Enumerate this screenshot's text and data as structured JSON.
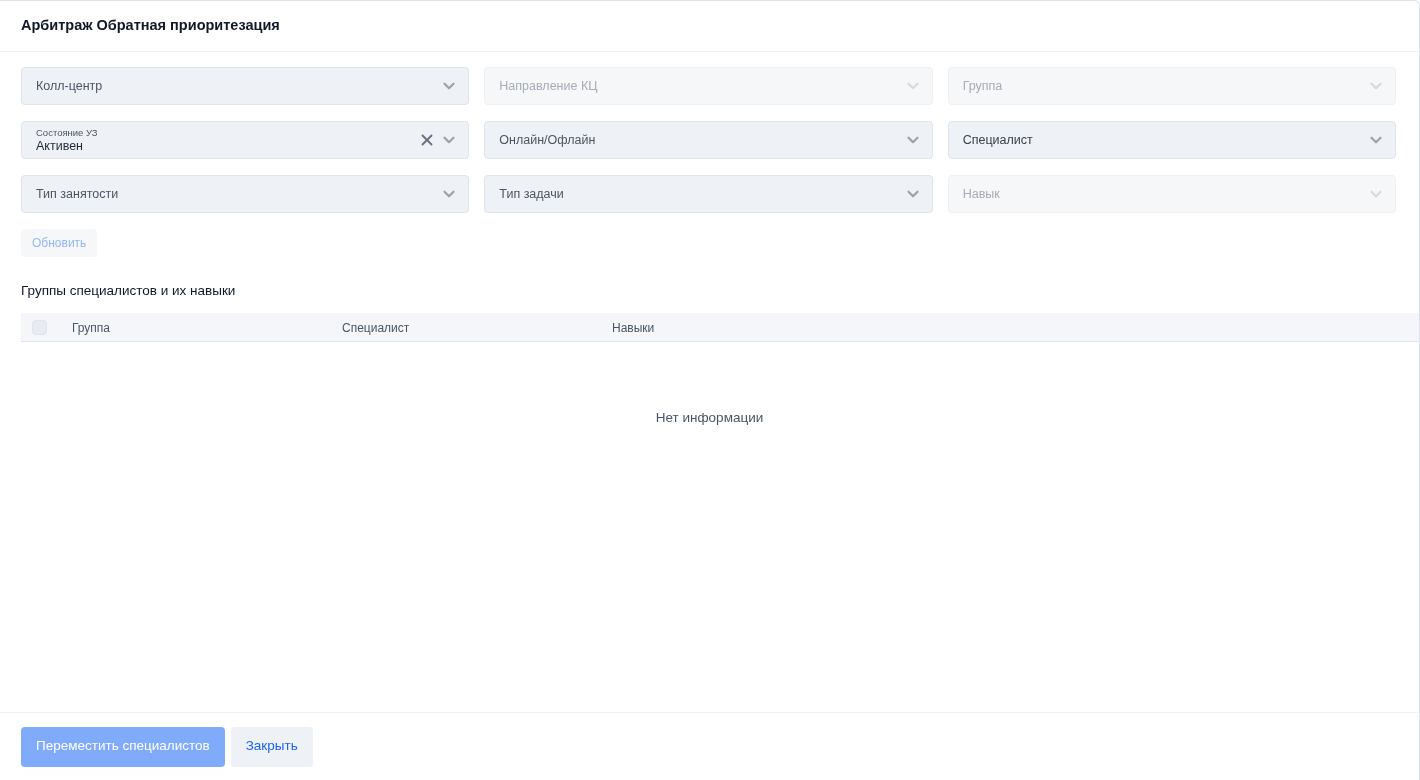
{
  "title": "Арбитраж Обратная приоритезация",
  "filters": [
    {
      "placeholder": "Колл-центр",
      "disabled": false
    },
    {
      "placeholder": "Направление КЦ",
      "disabled": true
    },
    {
      "placeholder": "Группа",
      "disabled": true
    },
    {
      "label": "Состояние УЗ",
      "value": "Активен",
      "disabled": false,
      "clearable": true
    },
    {
      "placeholder": "Онлайн/Офлайн",
      "disabled": false
    },
    {
      "placeholder": "Специалист",
      "disabled": false,
      "emphasis": true
    },
    {
      "placeholder": "Тип занятости",
      "disabled": false
    },
    {
      "placeholder": "Тип задачи",
      "disabled": false
    },
    {
      "placeholder": "Навык",
      "disabled": true
    }
  ],
  "refresh_button": {
    "label": "Обновить",
    "disabled": true
  },
  "section_title": "Группы специалистов и их навыки",
  "table": {
    "select_all": {
      "checked": false
    },
    "columns": [
      "Группа",
      "Специалист",
      "Навыки"
    ],
    "empty_text": "Нет информации"
  },
  "footer": {
    "buttons": [
      {
        "label": "Переместить специалистов",
        "kind": "primary",
        "disabled": true
      },
      {
        "label": "Закрыть",
        "kind": "secondary",
        "disabled": false
      }
    ]
  }
}
